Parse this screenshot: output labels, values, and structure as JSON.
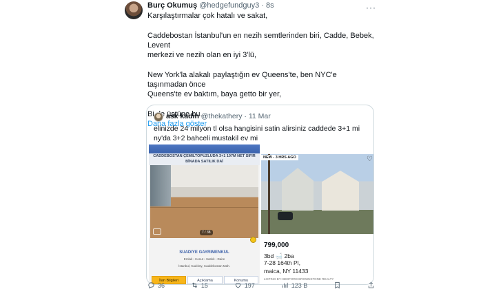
{
  "tweet": {
    "author_name": "Burç Okumuş",
    "author_handle": "@hedgefundguy3",
    "time": "· 8s",
    "more": "···",
    "text_lines": [
      "Karşılaştırmalar çok hatalı ve sakat,",
      "",
      "Caddebostan İstanbul'un en nezih semtlerinden biri, Cadde, Bebek, Levent",
      "merkezi ve nezih olan en iyi 3'lü,",
      "",
      "New York'la alakalı paylaştığın ev Queens'te, ben NYC'e taşınmadan önce",
      "Queens'te ev baktım, baya getto bir yer,",
      "",
      "Bi de üstüne bu..."
    ],
    "show_more": "Daha fazla göster"
  },
  "quote": {
    "author_name": "ask kadin",
    "author_handle": "@thekathery",
    "date": "· 11 Mar",
    "text": "elinizde 24 milyon tl olsa hangisini satin alirsiniz caddede 3+1 mi ny'da 3+2 bahceli mustakil ev mi"
  },
  "listing_tr": {
    "banner": "CADDEBOSTAN ÇEMILTOPUZLUDA 3+1 107M NET SIFIR BİNADA SATILIK DAİ",
    "photo_counter": "7 / 38",
    "agency": "SUADIYE GAYRIMENKUL",
    "sub_line1": "Emlak › Konut › Satılık › Daire",
    "sub_line2": "İstanbul, Kadıköy, Caddebostan Mah.",
    "tabs": [
      "İlan Bilgileri",
      "Açıklama",
      "Konumu"
    ]
  },
  "listing_us": {
    "badge": "NEW - 3 HRS AGO",
    "price": "799,000",
    "specs": "3bd  🛁 2ba",
    "addr1": "7-28 164th Pl,",
    "addr2": "maica, NY 11433",
    "listing_by": "LISTING BY: BEDFORD BROWNSTONE REALTY"
  },
  "actions": {
    "replies": "36",
    "retweets": "15",
    "likes": "197",
    "views": "123 B"
  },
  "colors": {
    "link": "#1d9bf0",
    "secondary": "#536471",
    "border": "#cfd9de"
  }
}
